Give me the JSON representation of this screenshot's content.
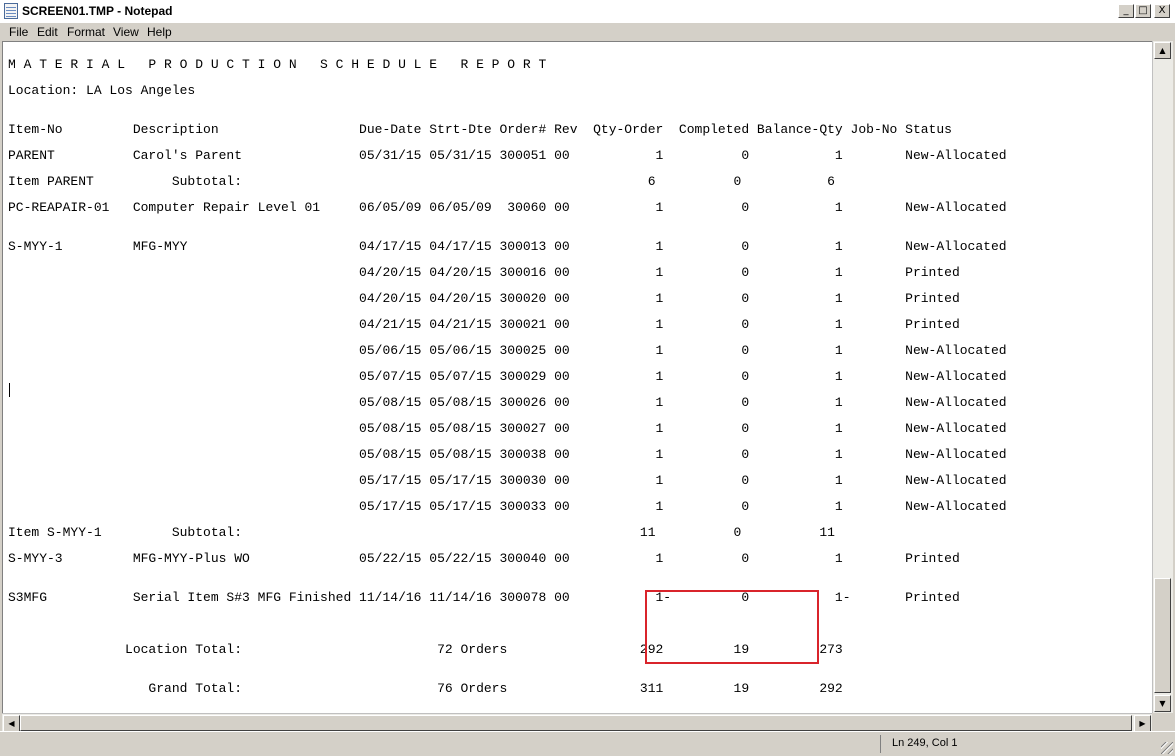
{
  "window": {
    "title": "SCREEN01.TMP - Notepad",
    "controls": {
      "minimize": "_",
      "maximize": "□",
      "close": "X"
    }
  },
  "menu": [
    "File",
    "Edit",
    "Format",
    "View",
    "Help"
  ],
  "report": {
    "title": "M A T E R I A L   P R O D U C T I O N   S C H E D U L E   R E P O R T",
    "location": "Location: LA Los Angeles",
    "header": "Item-No         Description                  Due-Date Strt-Dte Order# Rev  Qty-Order  Completed Balance-Qty Job-No Status",
    "lines": [
      "PARENT          Carol's Parent               05/31/15 05/31/15 300051 00           1          0           1        New-Allocated",
      "Item PARENT          Subtotal:                                                    6          0           6",
      "PC-REAPAIR-01   Computer Repair Level 01     06/05/09 06/05/09  30060 00           1          0           1        New-Allocated",
      "S-MYY-1         MFG-MYY                      04/17/15 04/17/15 300013 00           1          0           1        New-Allocated",
      "                                             04/20/15 04/20/15 300016 00           1          0           1        Printed",
      "                                             04/20/15 04/20/15 300020 00           1          0           1        Printed",
      "                                             04/21/15 04/21/15 300021 00           1          0           1        Printed",
      "                                             05/06/15 05/06/15 300025 00           1          0           1        New-Allocated",
      "                                             05/07/15 05/07/15 300029 00           1          0           1        New-Allocated",
      "                                             05/08/15 05/08/15 300026 00           1          0           1        New-Allocated",
      "                                             05/08/15 05/08/15 300027 00           1          0           1        New-Allocated",
      "                                             05/08/15 05/08/15 300038 00           1          0           1        New-Allocated",
      "                                             05/17/15 05/17/15 300030 00           1          0           1        New-Allocated",
      "                                             05/17/15 05/17/15 300033 00           1          0           1        New-Allocated",
      "Item S-MYY-1         Subtotal:                                                   11          0          11",
      "S-MYY-3         MFG-MYY-Plus WO              05/22/15 05/22/15 300040 00           1          0           1        Printed",
      "S3MFG           Serial Item S#3 MFG Finished 11/14/16 11/14/16 300078 00           1-         0           1-       Printed",
      "               Location Total:                         72 Orders                 292         19         273",
      "                  Grand Total:                         76 Orders                 311         19         292"
    ]
  },
  "status": {
    "position": "Ln 249, Col 1"
  }
}
